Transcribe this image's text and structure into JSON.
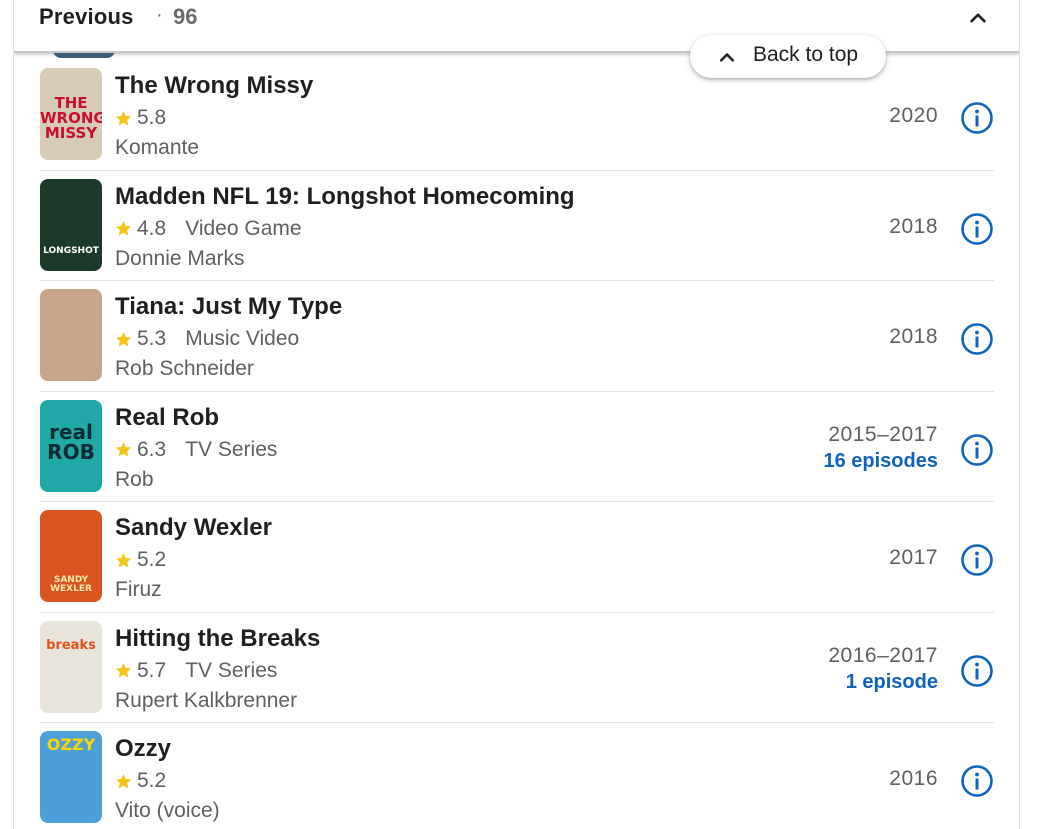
{
  "section": {
    "title": "Previous",
    "separator": "·",
    "count": "96",
    "collapse_icon": "chevron-up-icon"
  },
  "back_to_top": {
    "label": "Back to top",
    "icon": "chevron-up-icon"
  },
  "colors": {
    "star": "#f5c518",
    "link_blue": "#0e63be",
    "text_primary": "#1f1f1f",
    "text_secondary": "#5f5f5f"
  },
  "credits": [
    {
      "title": "The Wrong Missy",
      "rating": "5.8",
      "type": "",
      "role": "Komante",
      "year": "2020",
      "episodes": "",
      "poster": {
        "bg": "#d8cbb6",
        "text": "THE WRONG MISSY",
        "text_color": "#c8102e"
      }
    },
    {
      "title": "Madden NFL 19: Longshot Homecoming",
      "rating": "4.8",
      "type": "Video Game",
      "role": "Donnie Marks",
      "year": "2018",
      "episodes": "",
      "poster": {
        "bg": "#1c3a2a",
        "text": "LONGSHOT",
        "text_color": "#ffffff"
      }
    },
    {
      "title": "Tiana: Just My Type",
      "rating": "5.3",
      "type": "Music Video",
      "role": "Rob Schneider",
      "year": "2018",
      "episodes": "",
      "poster": {
        "bg": "#c9a58a",
        "text": "",
        "text_color": "#ffffff"
      }
    },
    {
      "title": "Real Rob",
      "rating": "6.3",
      "type": "TV Series",
      "role": "Rob",
      "year": "2015–2017",
      "episodes": "16 episodes",
      "poster": {
        "bg": "#20a8a6",
        "text": "real ROB",
        "text_color": "#0b2b33"
      }
    },
    {
      "title": "Sandy Wexler",
      "rating": "5.2",
      "type": "",
      "role": "Firuz",
      "year": "2017",
      "episodes": "",
      "poster": {
        "bg": "#d9541e",
        "text": "SANDY WEXLER",
        "text_color": "#ffe9a8"
      }
    },
    {
      "title": "Hitting the Breaks",
      "rating": "5.7",
      "type": "TV Series",
      "role": "Rupert Kalkbrenner",
      "year": "2016–2017",
      "episodes": "1 episode",
      "poster": {
        "bg": "#e9e4da",
        "text": "breaks",
        "text_color": "#e0531c"
      }
    },
    {
      "title": "Ozzy",
      "rating": "5.2",
      "type": "",
      "role": "Vito (voice)",
      "year": "2016",
      "episodes": "",
      "poster": {
        "bg": "#4d9fd8",
        "text": "OZZY",
        "text_color": "#ffd400"
      }
    }
  ]
}
